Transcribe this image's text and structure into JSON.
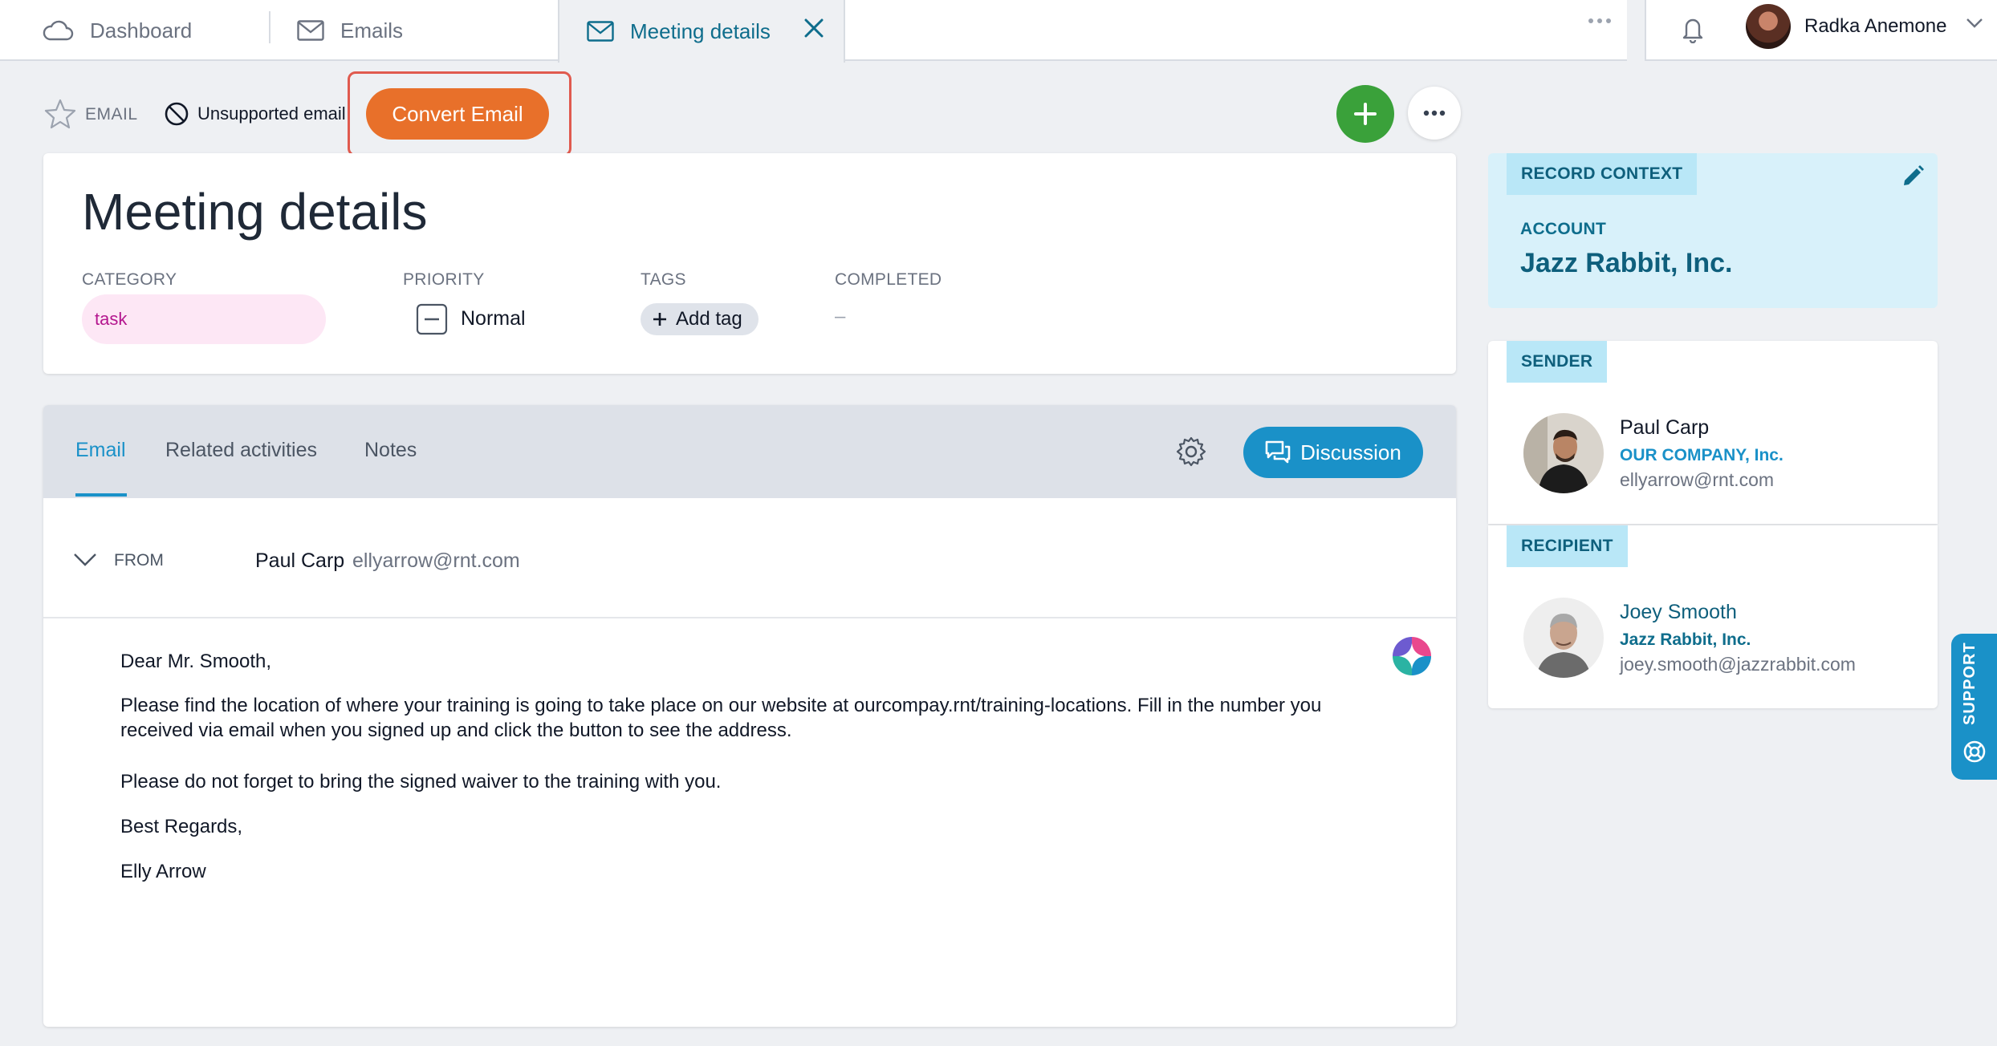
{
  "tabs": [
    {
      "label": "Dashboard",
      "icon": "cloud-icon"
    },
    {
      "label": "Emails",
      "icon": "mail-icon"
    },
    {
      "label": "Meeting details",
      "icon": "mail-icon",
      "active": true
    }
  ],
  "user": {
    "name": "Radka Anemone"
  },
  "actions": {
    "record_type": "EMAIL",
    "unsupported_label": "Unsupported email",
    "convert_label": "Convert Email"
  },
  "record": {
    "title": "Meeting details",
    "category_label": "CATEGORY",
    "category_value": "task",
    "priority_label": "PRIORITY",
    "priority_value": "Normal",
    "tags_label": "TAGS",
    "add_tag_label": "Add tag",
    "completed_label": "COMPLETED",
    "completed_value": "–"
  },
  "email_tabs": {
    "tabs": [
      "Email",
      "Related activities",
      "Notes"
    ],
    "active": "Email",
    "discussion_label": "Discussion"
  },
  "email": {
    "from_label": "FROM",
    "from_name": "Paul Carp",
    "from_email": "ellyarrow@rnt.com",
    "greeting": "Dear Mr. Smooth,",
    "paragraph1": "Please find the location of where your training is going to take place on our website at ourcompay.rnt/training-locations. Fill in the number you received via email when you signed up and click the button to see the address.",
    "paragraph2": "Please do not forget to bring the signed waiver to the training with you.",
    "closing": "Best Regards,",
    "signature": "Elly Arrow"
  },
  "context": {
    "badge": "RECORD CONTEXT",
    "account_label": "ACCOUNT",
    "account_value": "Jazz Rabbit, Inc."
  },
  "sender": {
    "badge": "SENDER",
    "name": "Paul Carp",
    "company": "OUR COMPANY, Inc.",
    "email": "ellyarrow@rnt.com"
  },
  "recipient": {
    "badge": "RECIPIENT",
    "name": "Joey Smooth",
    "company": "Jazz Rabbit, Inc.",
    "email": "joey.smooth@jazzrabbit.com"
  },
  "support_label": "SUPPORT",
  "colors": {
    "accent": "#1a91c8",
    "convert": "#e8702a",
    "add": "#3aa13a",
    "category_pill": "#fde7f5"
  }
}
